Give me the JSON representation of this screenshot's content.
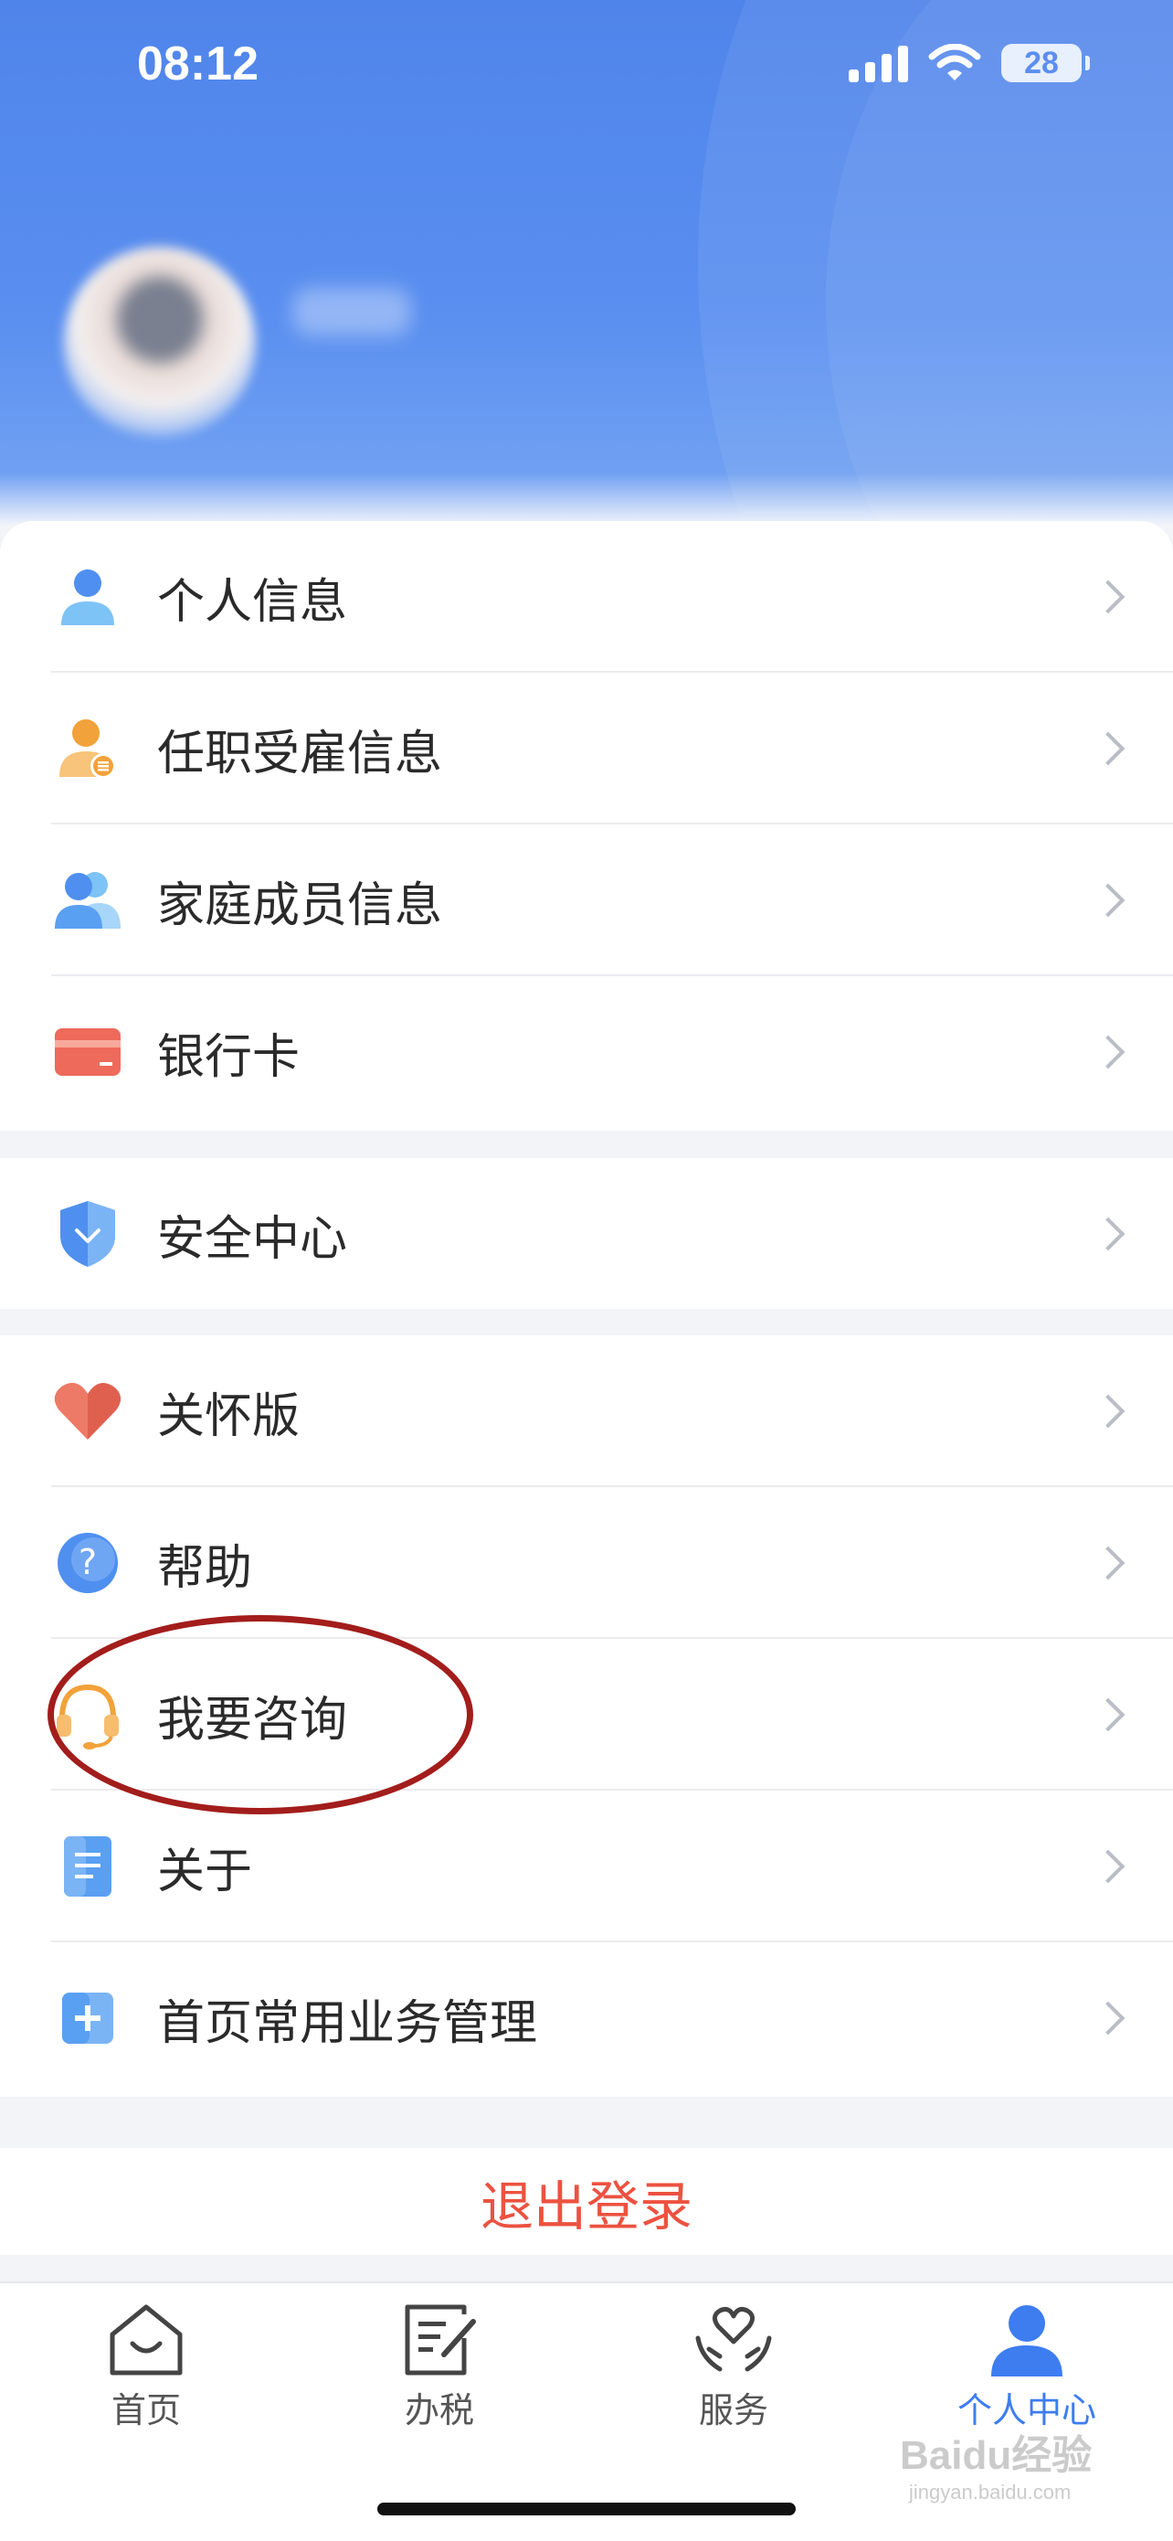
{
  "status_bar": {
    "time": "08:12",
    "battery": "28"
  },
  "group1": [
    {
      "label": "个人信息",
      "icon": "person-icon"
    },
    {
      "label": "任职受雇信息",
      "icon": "employment-icon"
    },
    {
      "label": "家庭成员信息",
      "icon": "family-icon"
    },
    {
      "label": "银行卡",
      "icon": "bank-card-icon"
    }
  ],
  "group2": [
    {
      "label": "安全中心",
      "icon": "shield-icon"
    }
  ],
  "group3": [
    {
      "label": "关怀版",
      "icon": "heart-icon"
    },
    {
      "label": "帮助",
      "icon": "help-icon"
    },
    {
      "label": "我要咨询",
      "icon": "headset-icon"
    },
    {
      "label": "关于",
      "icon": "document-icon"
    },
    {
      "label": "首页常用业务管理",
      "icon": "add-square-icon"
    }
  ],
  "logout_label": "退出登录",
  "tabs": [
    {
      "label": "首页",
      "icon": "home-icon"
    },
    {
      "label": "办税",
      "icon": "tax-edit-icon"
    },
    {
      "label": "服务",
      "icon": "service-heart-icon"
    },
    {
      "label": "个人中心",
      "icon": "user-center-icon",
      "active": true
    }
  ],
  "watermark": {
    "text": "Baidu经验",
    "sub": "jingyan.baidu.com"
  },
  "colors": {
    "primary": "#3d7df0",
    "logout": "#ec5240",
    "highlight_circle": "#a21d1b"
  }
}
